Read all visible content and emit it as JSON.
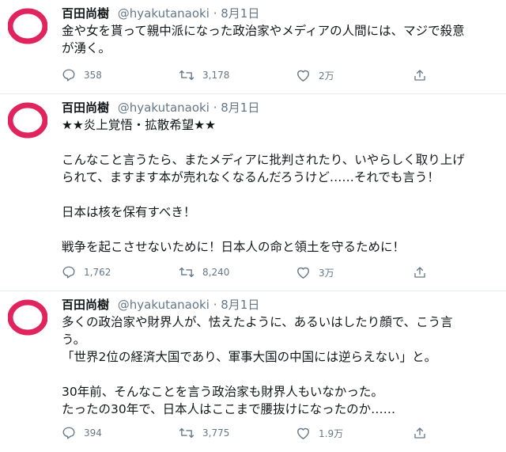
{
  "tweets": [
    {
      "name": "百田尚樹",
      "handle": "@hyakutanaoki",
      "separator": "·",
      "date": "8月1日",
      "lines": [
        "金や女を貰って親中派になった政治家やメディアの人間には、マジで殺意",
        "が湧く。"
      ],
      "replies": "358",
      "retweets": "3,178",
      "likes": "2万"
    },
    {
      "name": "百田尚樹",
      "handle": "@hyakutanaoki",
      "separator": "·",
      "date": "8月1日",
      "lines": [
        "★★炎上覚悟・拡散希望★★",
        "",
        "こんなこと言うたら、またメディアに批判されたり、いやらしく取り上げ",
        "られて、ますます本が売れなくなるんだろうけど……それでも言う！",
        "",
        "日本は核を保有すべき！",
        "",
        "戦争を起こさせないために！日本人の命と領土を守るために！"
      ],
      "replies": "1,762",
      "retweets": "8,240",
      "likes": "3万"
    },
    {
      "name": "百田尚樹",
      "handle": "@hyakutanaoki",
      "separator": "·",
      "date": "8月1日",
      "lines": [
        "多くの政治家や財界人が、怯えたように、あるいはしたり顔で、こう言",
        "う。",
        "「世界2位の経済大国であり、軍事大国の中国には逆らえない」と。",
        "",
        "30年前、そんなことを言う政治家も財界人もいなかった。",
        "たったの30年で、日本人はここまで腰抜けになったのか……"
      ],
      "replies": "394",
      "retweets": "3,775",
      "likes": "1.9万"
    }
  ],
  "colors": {
    "avatar_ring": "#e0245e",
    "secondary_text": "#657786",
    "divider": "#e6ecf0"
  },
  "icons": [
    "reply-icon",
    "retweet-icon",
    "like-icon",
    "share-icon"
  ]
}
